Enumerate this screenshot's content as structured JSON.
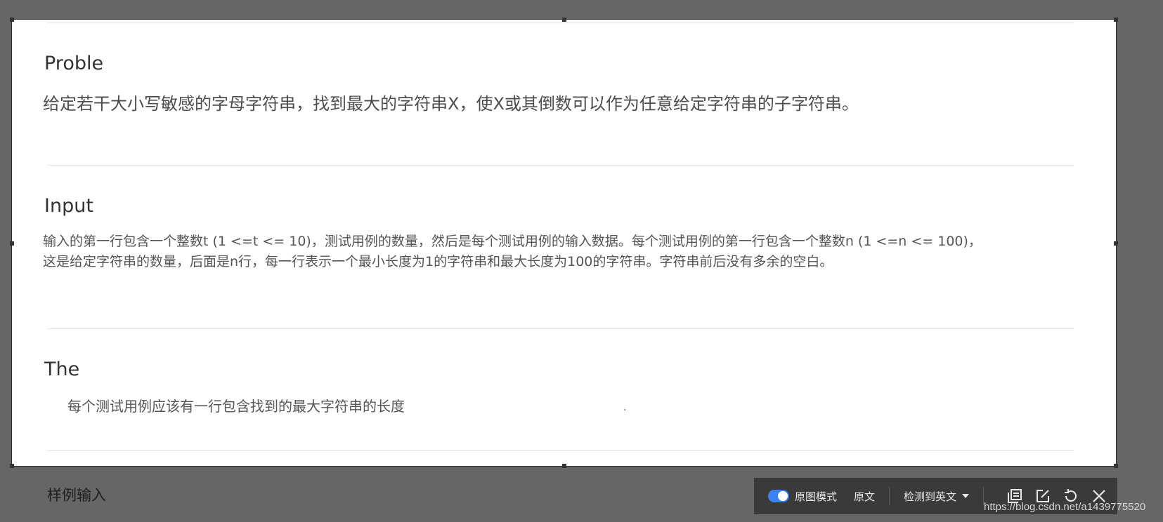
{
  "sections": {
    "problem": {
      "heading": "Proble",
      "text": "给定若干大小写敏感的字母字符串，找到最大的字符串X，使X或其倒数可以作为任意给定字符串的子字符串。"
    },
    "input": {
      "heading": "Input",
      "line1": "输入的第一行包含一个整数t (1 <=t <= 10)，测试用例的数量，然后是每个测试用例的输入数据。每个测试用例的第一行包含一个整数n (1 <=n <= 100)，",
      "line2": "这是给定字符串的数量，后面是n行，每一行表示一个最小长度为1的字符串和最大长度为100的字符串。字符串前后没有多余的空白。"
    },
    "output": {
      "heading": "The",
      "text": "每个测试用例应该有一行包含找到的最大字符串的长度",
      "dot": "."
    }
  },
  "below": {
    "sample_label": "样例输入"
  },
  "toolbar": {
    "toggle_label": "原图模式",
    "original_label": "原文",
    "detect_label": "检测到英文",
    "icons": [
      "copy-icon",
      "edit-icon",
      "refresh-icon",
      "close-icon"
    ]
  },
  "watermark": "https://blog.csdn.net/a1439775520",
  "colors": {
    "backdrop": "#666666",
    "panel": "#ffffff",
    "toolbar": "#3a3a3a",
    "toggle_accent": "#3b82f6"
  }
}
